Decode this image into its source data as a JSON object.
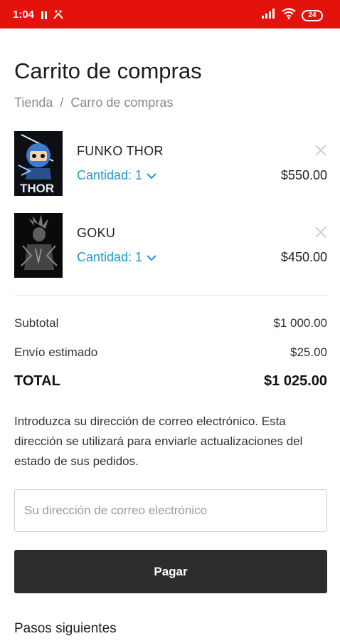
{
  "status_bar": {
    "time": "1:04",
    "battery": "24",
    "background_color": "#e3120b",
    "icons": [
      "pause-icon",
      "notification-icon",
      "signal-icon",
      "wifi-icon",
      "battery-icon"
    ]
  },
  "page": {
    "title": "Carrito de compras"
  },
  "breadcrumb": {
    "items": [
      "Tienda",
      "Carro de compras"
    ],
    "separator": "/"
  },
  "cart": {
    "items": [
      {
        "name": "FUNKO THOR",
        "quantity_label": "Cantidad: 1",
        "price": "$550.00",
        "image": "funko-thor-thumbnail"
      },
      {
        "name": "GOKU",
        "quantity_label": "Cantidad: 1",
        "price": "$450.00",
        "image": "goku-thumbnail"
      }
    ],
    "accent_color": "#1a9bc8"
  },
  "summary": {
    "subtotal_label": "Subtotal",
    "subtotal_value": "$1 000.00",
    "shipping_label": "Envío estimado",
    "shipping_value": "$25.00",
    "total_label": "TOTAL",
    "total_value": "$1 025.00"
  },
  "email_section": {
    "info_text": "Introduzca su dirección de correo electrónico. Esta dirección se utilizará para enviarle actualizaciones del estado de sus pedidos.",
    "placeholder": "Su dirección de correo electrónico",
    "value": ""
  },
  "pay_button": {
    "label": "Pagar",
    "color": "#2d2d2d"
  },
  "next_steps": {
    "title": "Pasos siguientes"
  }
}
